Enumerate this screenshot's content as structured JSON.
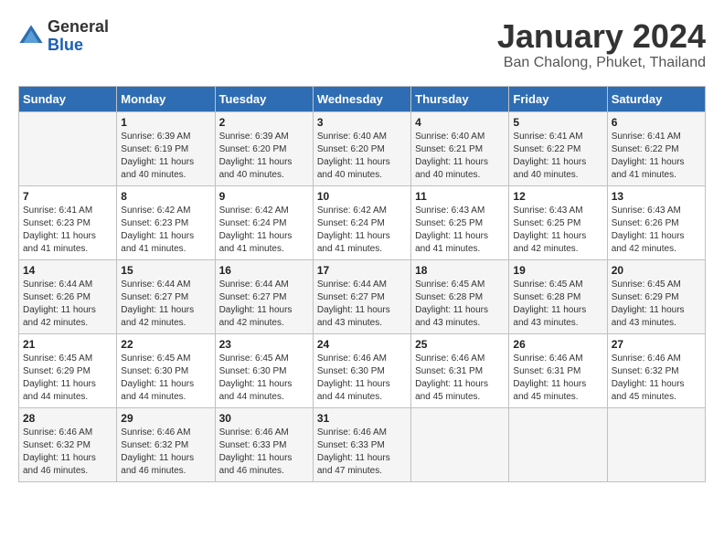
{
  "header": {
    "logo": {
      "line1": "General",
      "line2": "Blue"
    },
    "title": "January 2024",
    "subtitle": "Ban Chalong, Phuket, Thailand"
  },
  "days_of_week": [
    "Sunday",
    "Monday",
    "Tuesday",
    "Wednesday",
    "Thursday",
    "Friday",
    "Saturday"
  ],
  "weeks": [
    [
      {
        "day": "",
        "info": ""
      },
      {
        "day": "1",
        "info": "Sunrise: 6:39 AM\nSunset: 6:19 PM\nDaylight: 11 hours and 40 minutes."
      },
      {
        "day": "2",
        "info": "Sunrise: 6:39 AM\nSunset: 6:20 PM\nDaylight: 11 hours and 40 minutes."
      },
      {
        "day": "3",
        "info": "Sunrise: 6:40 AM\nSunset: 6:20 PM\nDaylight: 11 hours and 40 minutes."
      },
      {
        "day": "4",
        "info": "Sunrise: 6:40 AM\nSunset: 6:21 PM\nDaylight: 11 hours and 40 minutes."
      },
      {
        "day": "5",
        "info": "Sunrise: 6:41 AM\nSunset: 6:22 PM\nDaylight: 11 hours and 40 minutes."
      },
      {
        "day": "6",
        "info": "Sunrise: 6:41 AM\nSunset: 6:22 PM\nDaylight: 11 hours and 41 minutes."
      }
    ],
    [
      {
        "day": "7",
        "info": "Sunrise: 6:41 AM\nSunset: 6:23 PM\nDaylight: 11 hours and 41 minutes."
      },
      {
        "day": "8",
        "info": "Sunrise: 6:42 AM\nSunset: 6:23 PM\nDaylight: 11 hours and 41 minutes."
      },
      {
        "day": "9",
        "info": "Sunrise: 6:42 AM\nSunset: 6:24 PM\nDaylight: 11 hours and 41 minutes."
      },
      {
        "day": "10",
        "info": "Sunrise: 6:42 AM\nSunset: 6:24 PM\nDaylight: 11 hours and 41 minutes."
      },
      {
        "day": "11",
        "info": "Sunrise: 6:43 AM\nSunset: 6:25 PM\nDaylight: 11 hours and 41 minutes."
      },
      {
        "day": "12",
        "info": "Sunrise: 6:43 AM\nSunset: 6:25 PM\nDaylight: 11 hours and 42 minutes."
      },
      {
        "day": "13",
        "info": "Sunrise: 6:43 AM\nSunset: 6:26 PM\nDaylight: 11 hours and 42 minutes."
      }
    ],
    [
      {
        "day": "14",
        "info": "Sunrise: 6:44 AM\nSunset: 6:26 PM\nDaylight: 11 hours and 42 minutes."
      },
      {
        "day": "15",
        "info": "Sunrise: 6:44 AM\nSunset: 6:27 PM\nDaylight: 11 hours and 42 minutes."
      },
      {
        "day": "16",
        "info": "Sunrise: 6:44 AM\nSunset: 6:27 PM\nDaylight: 11 hours and 42 minutes."
      },
      {
        "day": "17",
        "info": "Sunrise: 6:44 AM\nSunset: 6:27 PM\nDaylight: 11 hours and 43 minutes."
      },
      {
        "day": "18",
        "info": "Sunrise: 6:45 AM\nSunset: 6:28 PM\nDaylight: 11 hours and 43 minutes."
      },
      {
        "day": "19",
        "info": "Sunrise: 6:45 AM\nSunset: 6:28 PM\nDaylight: 11 hours and 43 minutes."
      },
      {
        "day": "20",
        "info": "Sunrise: 6:45 AM\nSunset: 6:29 PM\nDaylight: 11 hours and 43 minutes."
      }
    ],
    [
      {
        "day": "21",
        "info": "Sunrise: 6:45 AM\nSunset: 6:29 PM\nDaylight: 11 hours and 44 minutes."
      },
      {
        "day": "22",
        "info": "Sunrise: 6:45 AM\nSunset: 6:30 PM\nDaylight: 11 hours and 44 minutes."
      },
      {
        "day": "23",
        "info": "Sunrise: 6:45 AM\nSunset: 6:30 PM\nDaylight: 11 hours and 44 minutes."
      },
      {
        "day": "24",
        "info": "Sunrise: 6:46 AM\nSunset: 6:30 PM\nDaylight: 11 hours and 44 minutes."
      },
      {
        "day": "25",
        "info": "Sunrise: 6:46 AM\nSunset: 6:31 PM\nDaylight: 11 hours and 45 minutes."
      },
      {
        "day": "26",
        "info": "Sunrise: 6:46 AM\nSunset: 6:31 PM\nDaylight: 11 hours and 45 minutes."
      },
      {
        "day": "27",
        "info": "Sunrise: 6:46 AM\nSunset: 6:32 PM\nDaylight: 11 hours and 45 minutes."
      }
    ],
    [
      {
        "day": "28",
        "info": "Sunrise: 6:46 AM\nSunset: 6:32 PM\nDaylight: 11 hours and 46 minutes."
      },
      {
        "day": "29",
        "info": "Sunrise: 6:46 AM\nSunset: 6:32 PM\nDaylight: 11 hours and 46 minutes."
      },
      {
        "day": "30",
        "info": "Sunrise: 6:46 AM\nSunset: 6:33 PM\nDaylight: 11 hours and 46 minutes."
      },
      {
        "day": "31",
        "info": "Sunrise: 6:46 AM\nSunset: 6:33 PM\nDaylight: 11 hours and 47 minutes."
      },
      {
        "day": "",
        "info": ""
      },
      {
        "day": "",
        "info": ""
      },
      {
        "day": "",
        "info": ""
      }
    ]
  ]
}
